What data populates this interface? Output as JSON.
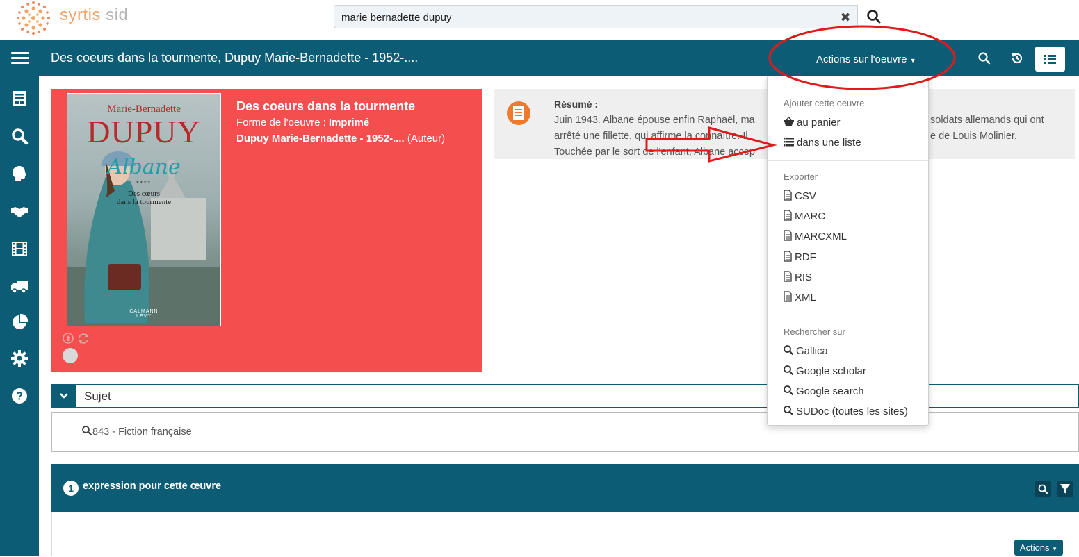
{
  "brand": {
    "part1": "syrtis",
    "part2": " sid",
    "logo_icon": "sunburst-logo-icon"
  },
  "search": {
    "value": "marie bernadette dupuy",
    "clear_icon": "close-icon",
    "search_icon": "search-icon"
  },
  "navbar": {
    "title": "Des coeurs dans la tourmente, Dupuy Marie-Bernadette - 1952-....",
    "actions_label": "Actions sur l'oeuvre",
    "color": "#0d5c75"
  },
  "sidebar": {
    "icons": [
      "catalogue-icon",
      "search-icon",
      "head-icon",
      "handshake-icon",
      "film-icon",
      "truck-icon",
      "pie-chart-icon",
      "gear-icon",
      "help-icon"
    ]
  },
  "work": {
    "title": "Des coeurs dans la tourmente",
    "forme_label": "Forme de l'oeuvre : ",
    "forme_value": "Imprimé",
    "author": "Dupuy Marie-Bernadette - 1952-....",
    "author_role": " (Auteur)",
    "cover": {
      "author_top": "Marie-Bernadette",
      "author_big": "DUPUY",
      "series": "Albane",
      "stars": "****",
      "subtitle_line1": "Des cœurs",
      "subtitle_line2": "dans la tourmente",
      "publisher_line1": "CALMANN",
      "publisher_line2": "LEVY"
    },
    "bg_color": "#f54e4e"
  },
  "resume": {
    "label": "Résumé :",
    "line1_a": "Juin 1943. Albane épouse enfin Raphaël, ma",
    "line1_b": "soldats allemands qui ont",
    "line2_a": "arrêté une fillette, qui affirme la connaître. Il",
    "line2_b": "e de Louis Molinier.",
    "line3": "Touchée par le sort de l'enfant, Albane accep"
  },
  "dropdown": {
    "section_add": "Ajouter cette oeuvre",
    "add_items": [
      {
        "label": "au panier",
        "icon": "basket-icon"
      },
      {
        "label": "dans une liste",
        "icon": "list-icon"
      }
    ],
    "section_export": "Exporter",
    "export_items": [
      {
        "label": "CSV",
        "icon": "file-icon"
      },
      {
        "label": "MARC",
        "icon": "file-icon"
      },
      {
        "label": "MARCXML",
        "icon": "file-icon"
      },
      {
        "label": "RDF",
        "icon": "file-icon"
      },
      {
        "label": "RIS",
        "icon": "file-icon"
      },
      {
        "label": "XML",
        "icon": "file-icon"
      }
    ],
    "section_search": "Rechercher sur",
    "search_items": [
      {
        "label": "Gallica",
        "icon": "search-icon"
      },
      {
        "label": "Google scholar",
        "icon": "search-icon"
      },
      {
        "label": "Google search",
        "icon": "search-icon"
      },
      {
        "label": "SUDoc (toutes les sites)",
        "icon": "search-icon"
      }
    ]
  },
  "sujet": {
    "label": "Sujet",
    "item": "843 - Fiction française"
  },
  "expressions": {
    "count": "1",
    "label": "expression pour cette œuvre",
    "actions_label": "Actions"
  }
}
